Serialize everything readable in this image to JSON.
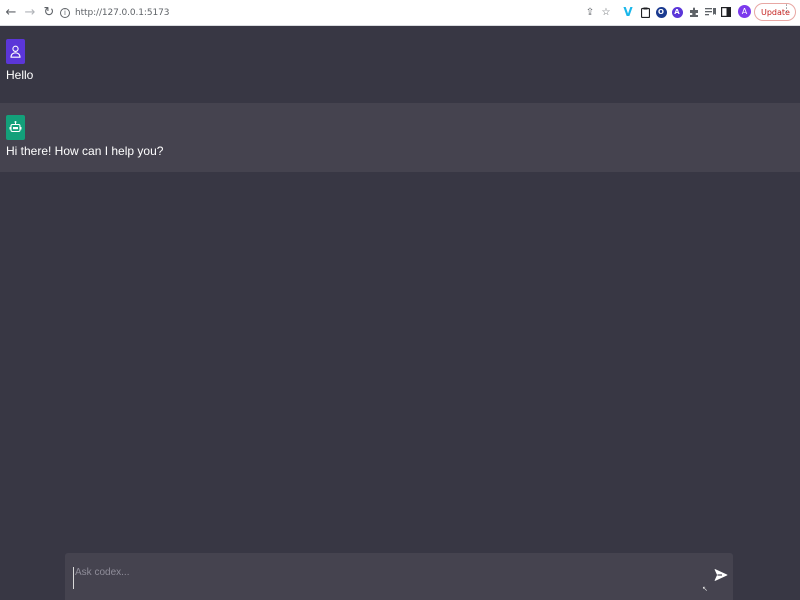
{
  "browser": {
    "url": "http://127.0.0.1:5173",
    "extensions": [
      {
        "name": "vimeo-icon",
        "glyph": "V",
        "color": "#1ab7ea"
      },
      {
        "name": "clipboard-icon",
        "glyph": "▯"
      },
      {
        "name": "o-extension-icon",
        "glyph": "O",
        "color": "#1a73e8"
      },
      {
        "name": "a-extension-icon",
        "glyph": "A",
        "color": "#5b36d8"
      },
      {
        "name": "puzzle-icon",
        "glyph": "✱"
      },
      {
        "name": "reading-list-icon",
        "glyph": "≡"
      },
      {
        "name": "side-panel-icon",
        "glyph": "◧"
      }
    ],
    "profile_initial": "A",
    "update_label": "Update"
  },
  "chat": {
    "messages": [
      {
        "role": "user",
        "text": "Hello",
        "avatar_color": "#5b36d8"
      },
      {
        "role": "bot",
        "text": "Hi there! How can I help you?",
        "avatar_color": "#13a07a"
      }
    ]
  },
  "composer": {
    "placeholder": "Ask codex...",
    "value": ""
  },
  "colors": {
    "background": "#383744",
    "bot_row": "#45434f",
    "composer": "#45434f"
  }
}
